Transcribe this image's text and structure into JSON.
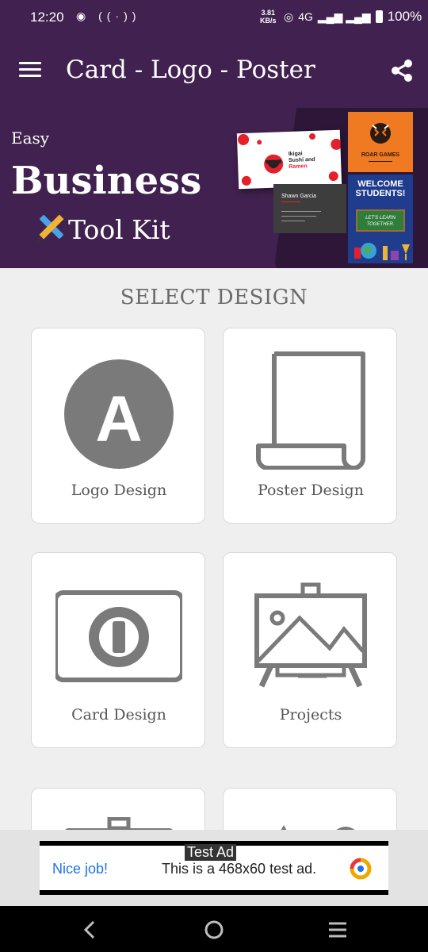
{
  "status": {
    "time": "12:20",
    "net_speed_value": "3.81",
    "net_speed_unit": "KB/s",
    "network": "4G",
    "battery": "100%"
  },
  "appbar": {
    "title": "Card - Logo - Poster",
    "menu_icon": "hamburger-menu-icon",
    "share_icon": "share-icon"
  },
  "banner": {
    "line1": "Easy",
    "line2": "Business",
    "line3": "Tool Kit",
    "samples": {
      "sushi_line1": "Ikigai",
      "sushi_line2": "Sushi and",
      "sushi_line3": "Ramen",
      "contact_name": "Shawn Garcia",
      "logo_name": "ROAR GAMES",
      "poster_line1": "WELCOME",
      "poster_line2": "STUDENTS!",
      "poster_board1": "LET'S LEARN",
      "poster_board2": "TOGETHER."
    }
  },
  "main": {
    "section_title": "SELECT DESIGN",
    "tiles": [
      {
        "label": "Logo Design",
        "icon": "logo-a-icon"
      },
      {
        "label": "Poster Design",
        "icon": "scroll-icon"
      },
      {
        "label": "Card Design",
        "icon": "card-icon"
      },
      {
        "label": "Projects",
        "icon": "easel-icon"
      }
    ]
  },
  "ad": {
    "tag": "Test Ad",
    "headline": "Nice job!",
    "text": "This is a 468x60 test ad."
  },
  "colors": {
    "primary": "#41214f",
    "icon_gray": "#7a7a7a",
    "ad_link": "#1a73e8"
  }
}
